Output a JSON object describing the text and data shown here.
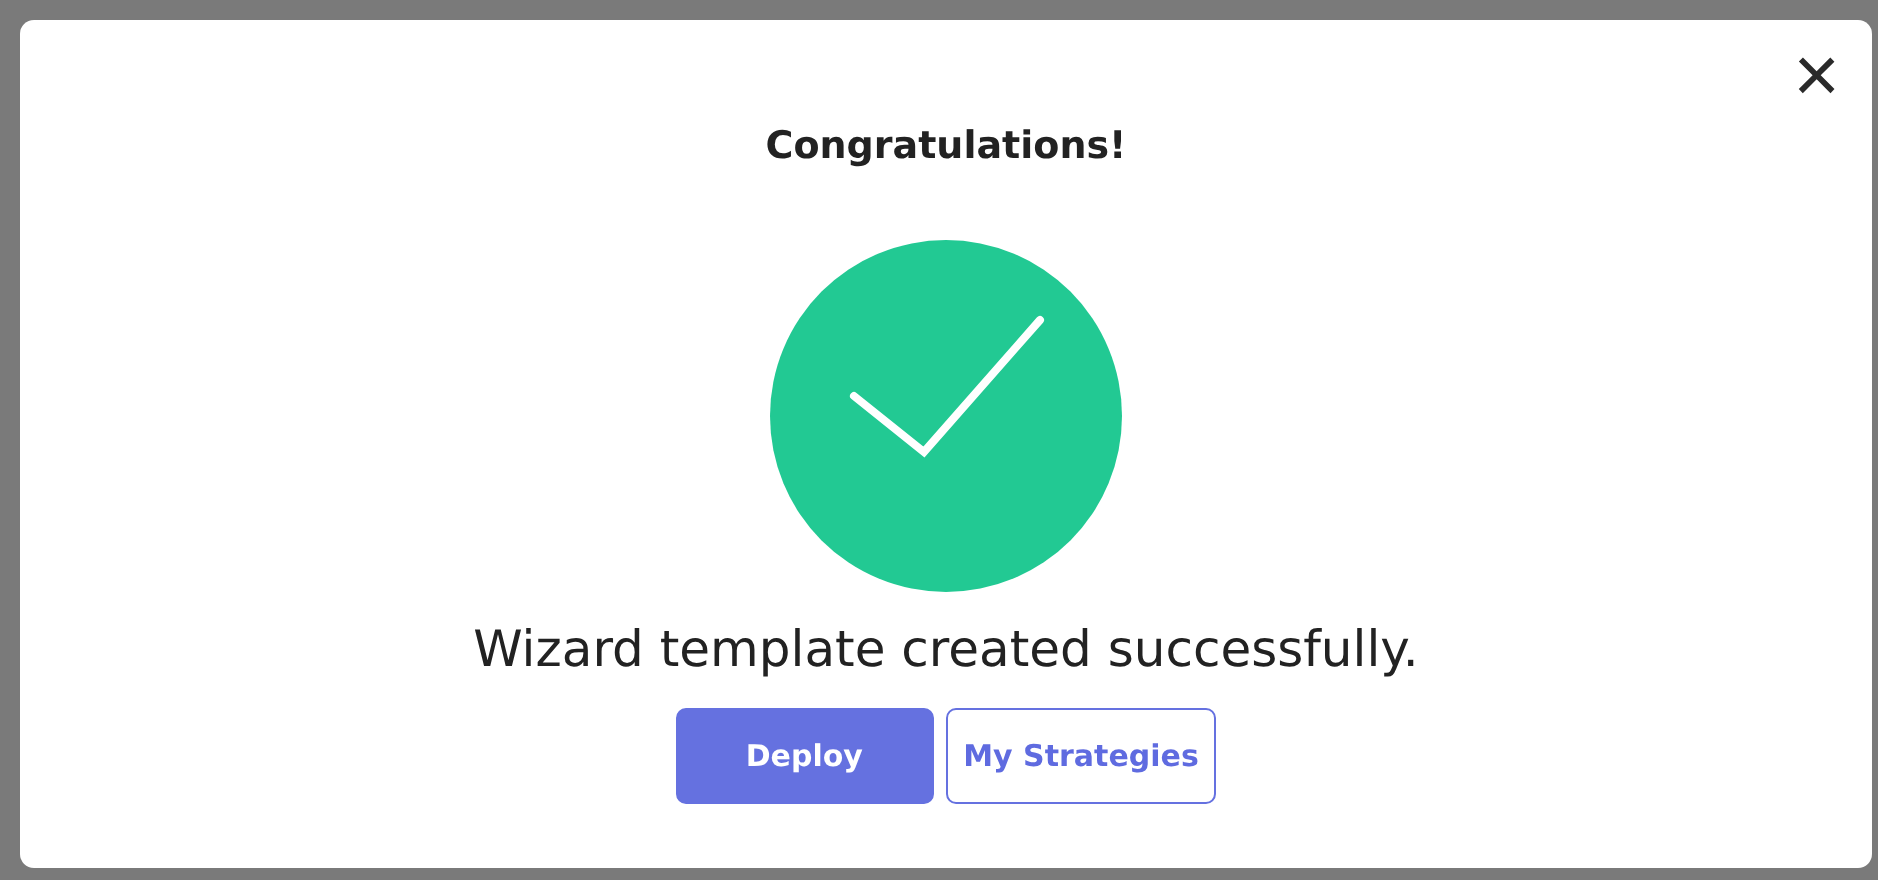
{
  "dialog": {
    "close": "×",
    "title": "Congratulations!",
    "success": true,
    "message": "Wizard template created successfully.",
    "buttons": [
      {
        "label": "Deploy",
        "kind": "primary"
      },
      {
        "label": "My Strategies",
        "kind": "outline"
      }
    ]
  }
}
